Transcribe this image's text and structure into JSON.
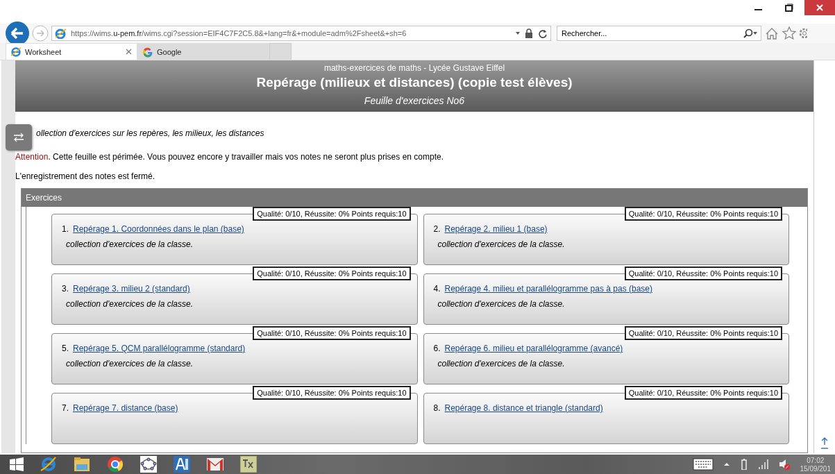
{
  "browser": {
    "url": "https://wims.**u-pem.fr**/wims.cgi?session=EIF4C7F2C5.8&+lang=fr&+module=adm%2Fsheet&+sh=6",
    "search_placeholder": "Rechercher...",
    "tabs": [
      {
        "label": "Worksheet",
        "selected": true
      },
      {
        "label": "Google",
        "selected": false
      }
    ]
  },
  "page": {
    "site": "maths-exercices de maths - Lycée Gustave Eiffel",
    "title": "Repérage (milieux et distances) (copie test élèves)",
    "subtitle": "Feuille d'exercices No6",
    "description": "ollection d'exercices sur les repères, les milieux, les distances",
    "attention_label": "Attention",
    "attention_message": ". Cette feuille est périmée. Vous pouvez encore y travailler mais vos notes ne seront plus prises en compte.",
    "registration_note": "L'enregistrement des notes est fermé.",
    "exercises": {
      "title": "Exercices",
      "items": [
        {
          "number": "1.",
          "title": "Repérage 1. Coordonnées dans le plan (base)",
          "description": "collection d'exercices de la classe.",
          "status": "Qualité: 0/10, Réussite: 0% Points requis:10"
        },
        {
          "number": "2.",
          "title": "Repérage 2. milieu 1 (base)",
          "description": "collection d'exercices de la classe.",
          "status": "Qualité: 0/10, Réussite: 0% Points requis:10"
        },
        {
          "number": "3.",
          "title": "Repérage 3. milieu 2 (standard)",
          "description": "collection d'exercices de la classe.",
          "status": "Qualité: 0/10, Réussite: 0% Points requis:10"
        },
        {
          "number": "4.",
          "title": "Repérage 4. milieu et parallélogramme pas à pas (base)",
          "description": "collection d'exercices de la classe.",
          "status": "Qualité: 0/10, Réussite: 0% Points requis:10"
        },
        {
          "number": "5.",
          "title": "Repérage 5. QCM parallélogramme (standard)",
          "description": "collection d'exercices de la classe.",
          "status": "Qualité: 0/10, Réussite: 0% Points requis:10"
        },
        {
          "number": "6.",
          "title": "Repérage 6. milieu et parallélogramme (avancé)",
          "description": "collection d'exercices de la classe.",
          "status": "Qualité: 0/10, Réussite: 0% Points requis:10"
        },
        {
          "number": "7.",
          "title": "Repérage 7. distance (base)",
          "status": "Qualité: 0/10, Réussite: 0% Points requis:10"
        },
        {
          "number": "8.",
          "title": "Repérage 8. distance et triangle (standard)",
          "status": "Qualité: 0/10, Réussite: 0% Points requis:10"
        }
      ]
    }
  },
  "taskbar": {
    "time": "07:02",
    "date": "15/09/201"
  }
}
